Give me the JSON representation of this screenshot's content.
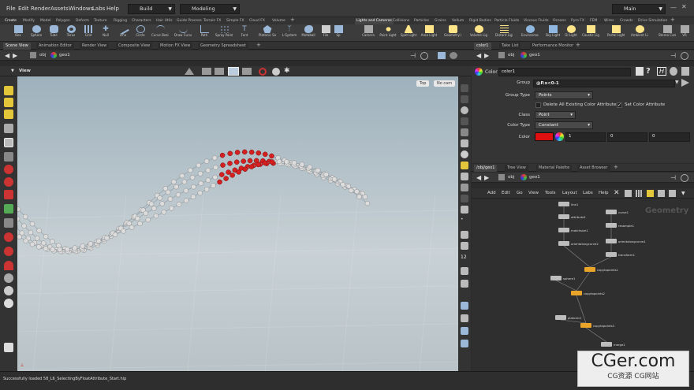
{
  "menu": {
    "items": [
      "File",
      "Edit",
      "Render",
      "Assets",
      "Windows",
      "Labs",
      "Help"
    ],
    "desktop": "Build",
    "mode": "Modeling",
    "right_desktop": "Main"
  },
  "shelf_tabs_left": [
    "Create",
    "Modify",
    "Model",
    "Polygon",
    "Deform",
    "Texture",
    "Rigging",
    "Characters",
    "Hair Utils",
    "Guide Process",
    "Terrain FX",
    "Simple FX",
    "Cloud FX",
    "Volume"
  ],
  "shelf_tabs_right": [
    "Lights and Cameras",
    "Collisions",
    "Particles",
    "Grains",
    "Vellum",
    "Rigid Bodies",
    "Particle Fluids",
    "Viscous Fluids",
    "Oceans",
    "Pyro FX",
    "FEM",
    "Wires",
    "Crowds",
    "Drive Simulation"
  ],
  "tools_left": [
    "Box",
    "Sphere",
    "Tube",
    "Torus",
    "Grid",
    "Null",
    "Line",
    "Circle",
    "Curve Bezier",
    "Draw Curve",
    "Path",
    "Spray Paint",
    "Font",
    "Platonic Solids",
    "L-System",
    "Metaball",
    "File",
    "Sp"
  ],
  "tools_right": [
    "Camera",
    "Point Light",
    "Spot Light",
    "Area Light",
    "Geometry Light",
    "Volume Light",
    "Distant Light",
    "Environment Light",
    "Sky Light",
    "GI Light",
    "Caustic Light",
    "Portal Light",
    "Ambient Light",
    "Stereo Camera",
    "VR"
  ],
  "left_pane_tabs": [
    "Scene View",
    "Animation Editor",
    "Render View",
    "Composite View",
    "Motion FX View",
    "Geometry Spreadsheet"
  ],
  "path": {
    "root": "obj",
    "node": "geo1"
  },
  "viewport": {
    "label": "View",
    "persp": "Top",
    "cam": "No cam"
  },
  "param_tabs": [
    "color1",
    "Take List",
    "Performance Monitor"
  ],
  "params": {
    "node_type": "Color",
    "node_name": "color1",
    "group_label": "Group",
    "group_value": "@P.x<0-1",
    "group_type_label": "Group Type",
    "group_type_value": "Points",
    "delete_existing_label": "Delete All Existing Color Attributes",
    "set_color_label": "Set Color Attribute",
    "class_label": "Class",
    "class_value": "Point",
    "color_type_label": "Color Type",
    "color_type_value": "Constant",
    "color_label": "Color",
    "color_r": "1",
    "color_g": "0",
    "color_b": "0",
    "color_swatch": "#e01010"
  },
  "net_tabs": [
    "/obj/geo1",
    "Tree View",
    "Material Palette",
    "Asset Browser"
  ],
  "net_menu": [
    "Add",
    "Edit",
    "Go",
    "View",
    "Tools",
    "Layout",
    "Labs",
    "Help"
  ],
  "net_watermark": "Geometry",
  "nodes": [
    "line1",
    "attribute1",
    "matchsize1",
    "orientalongcurve2",
    "curve1",
    "resample1",
    "orientalongcurve1",
    "transform1",
    "copytopoints1",
    "sphere1",
    "copytopoints2",
    "platonic1",
    "copytopoints3",
    "merge1"
  ],
  "status": "Successfully loaded 58_L6_SelectingByFloatAttribute_Start.hip",
  "watermark": {
    "big": "CGer.com",
    "small": "CG资源 CG网站"
  },
  "colors": {
    "accent_red": "#d62020",
    "node_orange": "#e8a52a"
  }
}
